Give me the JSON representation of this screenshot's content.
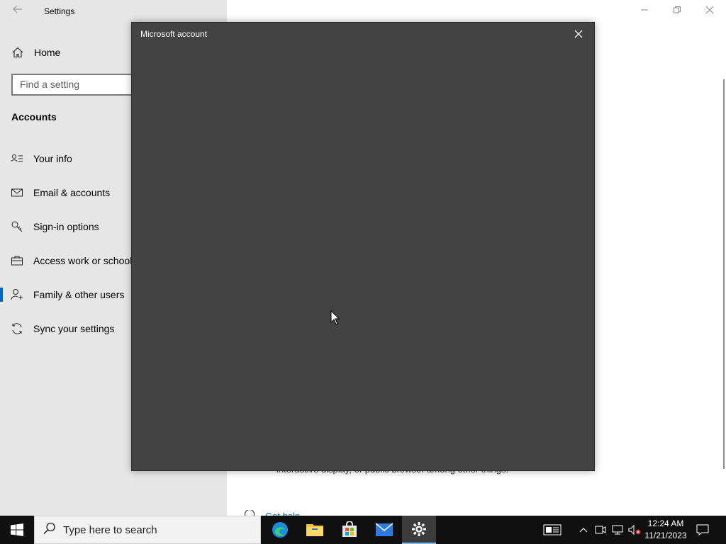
{
  "window": {
    "title": "Settings",
    "back_icon": "back-arrow-icon",
    "controls": [
      "minimize-icon",
      "restore-icon",
      "close-icon"
    ]
  },
  "sidebar": {
    "home_label": "Home",
    "search_placeholder": "Find a setting",
    "section_title": "Accounts",
    "items": [
      {
        "label": "Your info",
        "icon": "person-card-icon"
      },
      {
        "label": "Email & accounts",
        "icon": "mail-icon"
      },
      {
        "label": "Sign-in options",
        "icon": "key-icon"
      },
      {
        "label": "Access work or school",
        "icon": "briefcase-icon"
      },
      {
        "label": "Family & other users",
        "icon": "person-add-icon",
        "selected": true
      },
      {
        "label": "Sync your settings",
        "icon": "sync-icon"
      }
    ]
  },
  "main": {
    "partial_text": "interactive display, or public browser among other things.",
    "get_help_label": "Get help"
  },
  "dialog": {
    "title": "Microsoft account",
    "close_icon": "close-icon",
    "background": "#434343"
  },
  "taskbar": {
    "search_placeholder": "Type here to search",
    "apps": [
      "edge-icon",
      "file-explorer-icon",
      "store-icon",
      "mail-icon",
      "settings-gear-icon"
    ],
    "clock_time": "12:24 AM",
    "clock_date": "11/21/2023"
  },
  "colors": {
    "accent": "#0067c0",
    "sidebar_bg": "#e6e6e6",
    "taskbar_bg": "#101010",
    "dialog_bg": "#434343"
  }
}
